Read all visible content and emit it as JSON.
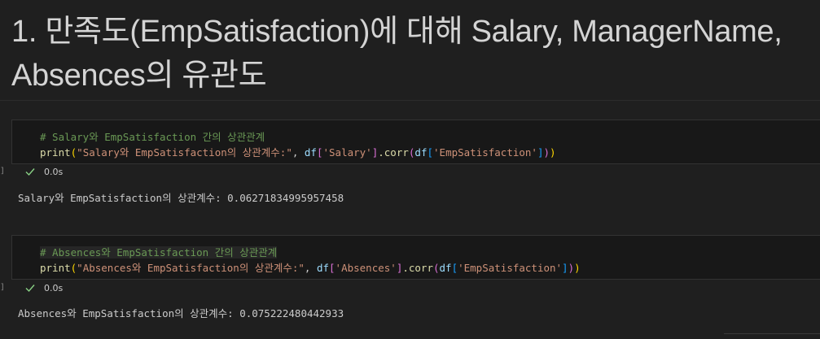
{
  "markdown": {
    "title": "1. 만족도(EmpSatisfaction)에 대해 Salary, ManagerName, Absences의 유관도"
  },
  "cells": [
    {
      "comment": "# Salary와 EmpSatisfaction 간의 상관관계",
      "code": {
        "func": "print",
        "paren_open": "(",
        "str": "\"Salary와 EmpSatisfaction의 상관계수:\"",
        "comma": ", ",
        "var1": "df",
        "b1": "[",
        "key1": "'Salary'",
        "b1c": "]",
        "method": ".corr",
        "p2": "(",
        "var2": "df",
        "b2": "[",
        "key2": "'EmpSatisfaction'",
        "b2c": "]",
        "p2c": ")",
        "paren_close": ")"
      },
      "status_time": "0.0s",
      "output": "Salary와 EmpSatisfaction의 상관계수: 0.06271834995957458"
    },
    {
      "comment": "# Absences와 EmpSatisfaction 간의 상관관계",
      "code": {
        "func": "print",
        "paren_open": "(",
        "str": "\"Absences와 EmpSatisfaction의 상관계수:\"",
        "comma": ", ",
        "var1": "df",
        "b1": "[",
        "key1": "'Absences'",
        "b1c": "]",
        "method": ".corr",
        "p2": "(",
        "var2": "df",
        "b2": "[",
        "key2": "'EmpSatisfaction'",
        "b2c": "]",
        "p2c": ")",
        "paren_close": ")"
      },
      "status_time": "0.0s",
      "output": "Absences와 EmpSatisfaction의 상관계수: 0.075222480442933"
    }
  ],
  "icons": {
    "status": "check-icon"
  },
  "colors": {
    "comment": "#6a9955",
    "function": "#dcdcaa",
    "string": "#ce9178",
    "variable": "#9cdcfe",
    "check": "#89d185",
    "background": "#1f1f1f",
    "editor_background": "#181818"
  }
}
